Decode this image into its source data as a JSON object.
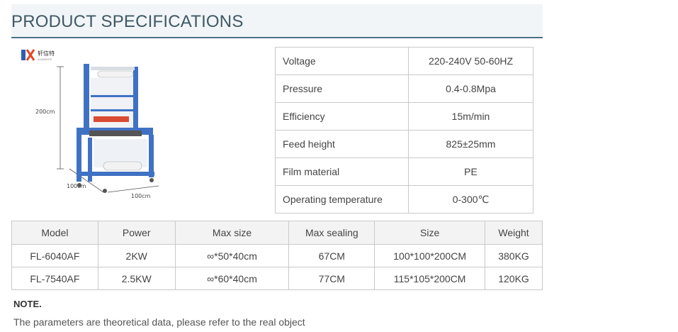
{
  "page_title": "PRODUCT SPECIFICATIONS",
  "figure": {
    "logo_text": "轩信特",
    "logo_sub": "XUANXINTE",
    "dims": {
      "height": "200cm",
      "depth": "100cm",
      "width": "100cm"
    }
  },
  "specs": [
    {
      "label": "Voltage",
      "value": "220-240V 50-60HZ"
    },
    {
      "label": "Pressure",
      "value": "0.4-0.8Mpa"
    },
    {
      "label": "Efficiency",
      "value": "15m/min"
    },
    {
      "label": "Feed height",
      "value": "825±25mm"
    },
    {
      "label": "Film material",
      "value": "PE"
    },
    {
      "label": "Operating temperature",
      "value": "0-300℃"
    }
  ],
  "models_table": {
    "headers": [
      "Model",
      "Power",
      "Max size",
      "Max sealing",
      "Size",
      "Weight"
    ],
    "rows": [
      [
        "FL-6040AF",
        "2KW",
        "∞*50*40cm",
        "67CM",
        "100*100*200CM",
        "380KG"
      ],
      [
        "FL-7540AF",
        "2.5KW",
        "∞*60*40cm",
        "77CM",
        "115*105*200CM",
        "120KG"
      ]
    ]
  },
  "note": {
    "title": "NOTE.",
    "text": "The parameters are theoretical data, please refer to the real object"
  }
}
